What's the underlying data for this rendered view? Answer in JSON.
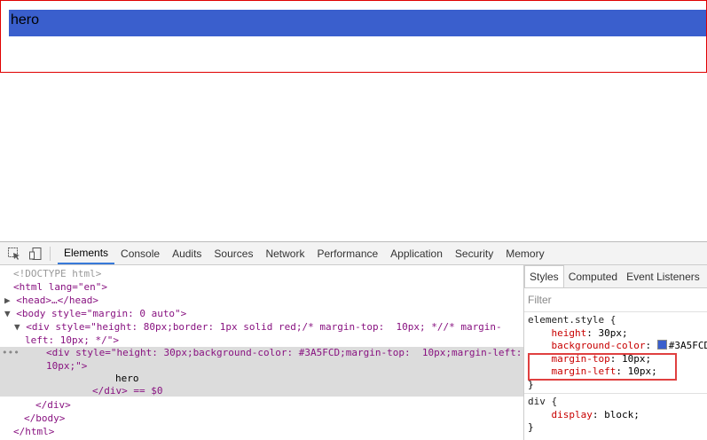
{
  "viewport": {
    "hero_text": "hero",
    "hero_color": "#3A5FCD",
    "outer_border_color": "#e00000"
  },
  "devtools": {
    "tabs": [
      "Elements",
      "Console",
      "Audits",
      "Sources",
      "Network",
      "Performance",
      "Application",
      "Security",
      "Memory"
    ],
    "active_tab": "Elements",
    "elements": {
      "doctype": "<!DOCTYPE html>",
      "html_open": "<html lang=\"en\">",
      "head": "<head>…</head>",
      "body_open": "<body style=\"margin: 0 auto\">",
      "outer_div_1": "<div style=\"height: 80px;border: 1px solid red;/* margin-top:  10px; *//* margin-",
      "outer_div_2": "left: 10px; */\">",
      "inner_div_1": "<div style=\"height: 30px;background-color: #3A5FCD;margin-top:  10px;margin-left:",
      "inner_div_2": "10px;\">",
      "hero_text": "hero",
      "inner_close": "</div> == $0",
      "div_close": "</div>",
      "body_close": "</body>",
      "html_close": "</html>"
    },
    "styles": {
      "tabs": [
        "Styles",
        "Computed",
        "Event Listeners"
      ],
      "active_tab": "Styles",
      "filter_placeholder": "Filter",
      "element_style_selector": "element.style {",
      "props": [
        {
          "name": "height",
          "value": "30px;"
        },
        {
          "name": "background-color",
          "value": "#3A5FCD;"
        },
        {
          "name": "margin-top",
          "value": "10px;"
        },
        {
          "name": "margin-left",
          "value": "10px;"
        }
      ],
      "close_brace": "}",
      "div_selector": "div {",
      "div_prop": {
        "name": "display",
        "value": "block;"
      }
    }
  }
}
